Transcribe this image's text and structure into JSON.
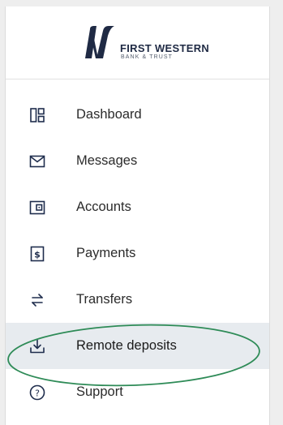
{
  "brand": {
    "name": "FIRST WESTERN",
    "subtitle": "BANK & TRUST",
    "logo_icon": "first-western-logo-mark",
    "color": "#1f2a44"
  },
  "nav": {
    "items": [
      {
        "label": "Dashboard",
        "icon": "dashboard-icon",
        "active": false
      },
      {
        "label": "Messages",
        "icon": "envelope-icon",
        "active": false
      },
      {
        "label": "Accounts",
        "icon": "wallet-icon",
        "active": false
      },
      {
        "label": "Payments",
        "icon": "receipt-dollar-icon",
        "active": false
      },
      {
        "label": "Transfers",
        "icon": "transfer-arrows-icon",
        "active": false
      },
      {
        "label": "Remote deposits",
        "icon": "download-tray-icon",
        "active": true
      },
      {
        "label": "Support",
        "icon": "question-circle-icon",
        "active": false
      }
    ]
  },
  "colors": {
    "icon": "#1f2d4d",
    "active_background": "#e7ebef",
    "highlight_oval": "#2e8b57"
  }
}
